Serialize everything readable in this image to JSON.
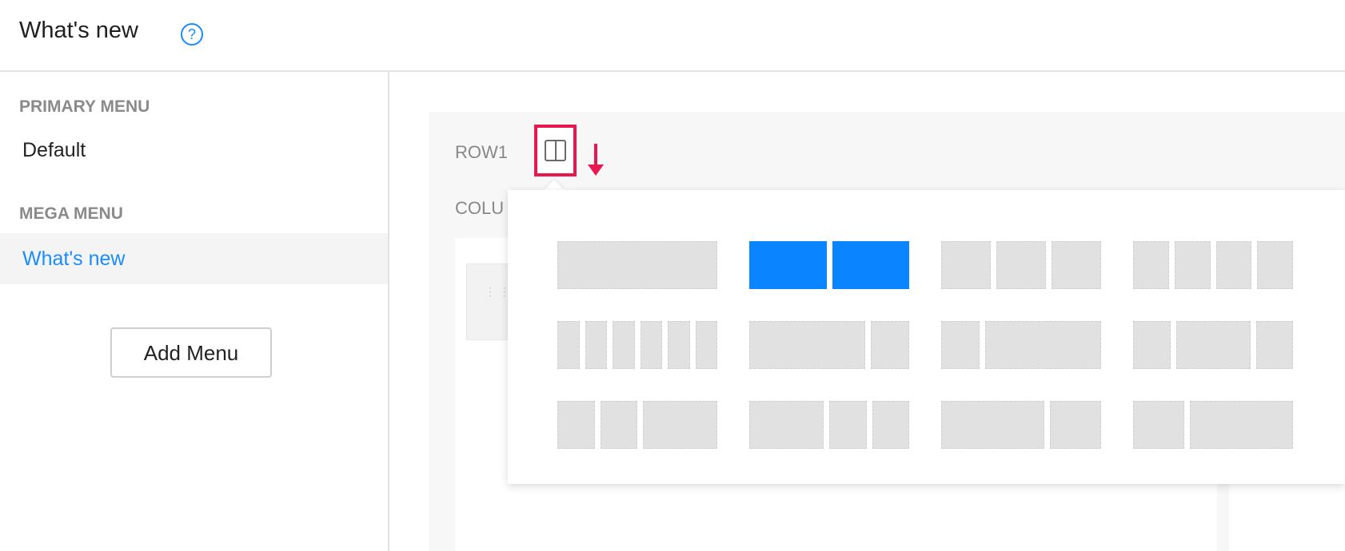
{
  "header": {
    "title": "What's new",
    "help_icon": "question-circle-icon"
  },
  "sidebar": {
    "primary_label": "PRIMARY MENU",
    "primary_items": [
      {
        "label": "Default"
      }
    ],
    "mega_label": "MEGA MENU",
    "mega_items": [
      {
        "label": "What's new",
        "active": true
      }
    ],
    "add_button": "Add Menu"
  },
  "builder": {
    "row_label": "ROW1",
    "column_label": "COLU",
    "layout_toggle_icon": "two-column-layout-icon",
    "arrow_icon": "arrow-down-icon",
    "drag_icon": "drag-handle-icon",
    "layout_options": [
      {
        "name": "1 column",
        "selected": false
      },
      {
        "name": "2 columns",
        "selected": true
      },
      {
        "name": "3 columns",
        "selected": false
      },
      {
        "name": "4 columns",
        "selected": false
      },
      {
        "name": "6 columns",
        "selected": false
      },
      {
        "name": "3/4 + 1/4",
        "selected": false
      },
      {
        "name": "1/4 + 3/4",
        "selected": false
      },
      {
        "name": "1/4 + 1/2 + 1/4",
        "selected": false
      },
      {
        "name": "1/4 + 1/4 + 1/2",
        "selected": false
      },
      {
        "name": "1/2 + 1/4 + 1/4",
        "selected": false
      },
      {
        "name": "2/3 + 1/3",
        "selected": false
      },
      {
        "name": "1/3 + 2/3",
        "selected": false
      }
    ]
  },
  "colors": {
    "accent": "#1a8cff",
    "selected_layout": "#0a84ff",
    "highlight_box": "#e8174f"
  }
}
